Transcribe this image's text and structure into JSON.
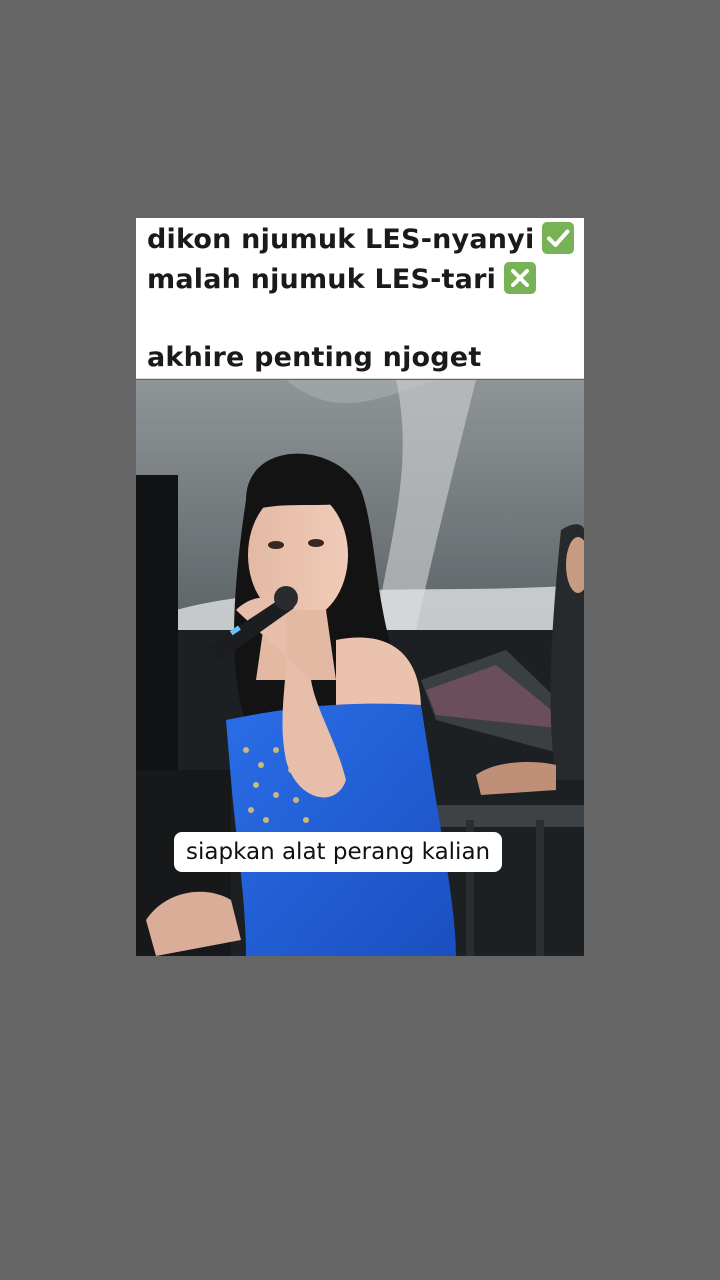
{
  "caption": {
    "line1": "dikon njumuk LES-nyanyi",
    "line2": "malah njumuk LES-tari",
    "line3": "akhire penting njoget",
    "line1_emoji": "check-mark-button-icon",
    "line2_emoji": "cross-mark-button-icon"
  },
  "video": {
    "subtitle": "siapkan alat perang kalian",
    "scene": "singer-with-microphone"
  },
  "colors": {
    "background": "#656565",
    "caption_bg": "#ffffff",
    "emoji_green": "#77b255",
    "dress_blue": "#1f5fd6"
  }
}
